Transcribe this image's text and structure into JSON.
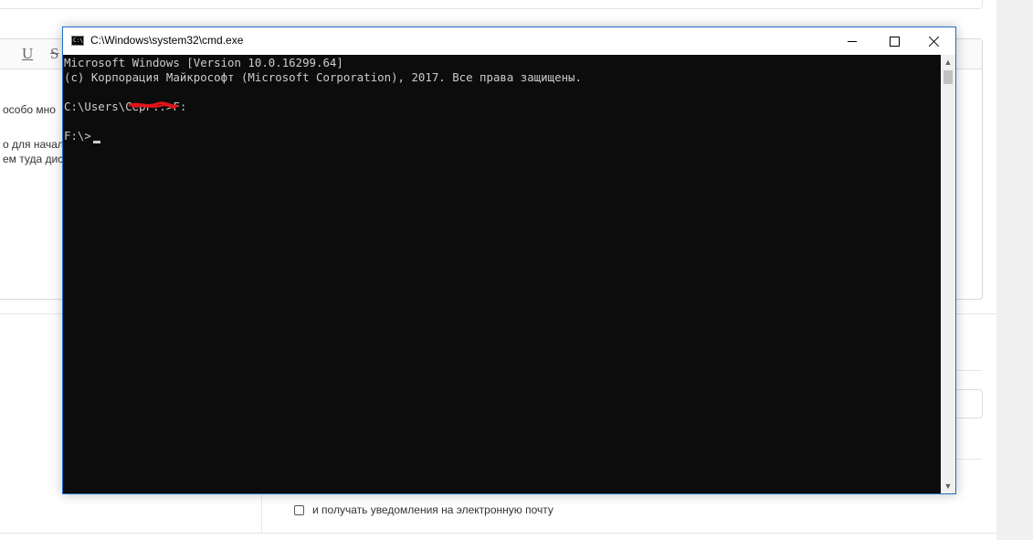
{
  "background_page": {
    "editor_toolbar": {
      "underline_label": "U",
      "strike_label": "S"
    },
    "editor_text_lines": [
      "особо мно",
      "о для начала",
      "ем туда дис"
    ],
    "notify_label": "и получать уведомления на электронную почту"
  },
  "cmd_window": {
    "title": "C:\\Windows\\system32\\cmd.exe",
    "icon_name": "cmd-icon",
    "icon_text": "C:\\",
    "controls": {
      "minimize_icon": "minimize-icon",
      "maximize_icon": "maximize-icon",
      "close_icon": "close-icon"
    },
    "console_lines": [
      "Microsoft Windows [Version 10.0.16299.64]",
      "(c) Корпорация Майкрософт (Microsoft Corporation), 2017. Все права защищены.",
      "",
      "C:\\Users\\Серг..>F:",
      "",
      "F:\\>"
    ],
    "colors": {
      "console_background": "#0c0c0c",
      "console_text": "#cccccc",
      "window_border": "#1f6fc4",
      "redaction": "#e0141b"
    },
    "scrollbar": {
      "up_icon": "scroll-up-arrow-icon",
      "down_icon": "scroll-down-arrow-icon"
    }
  }
}
